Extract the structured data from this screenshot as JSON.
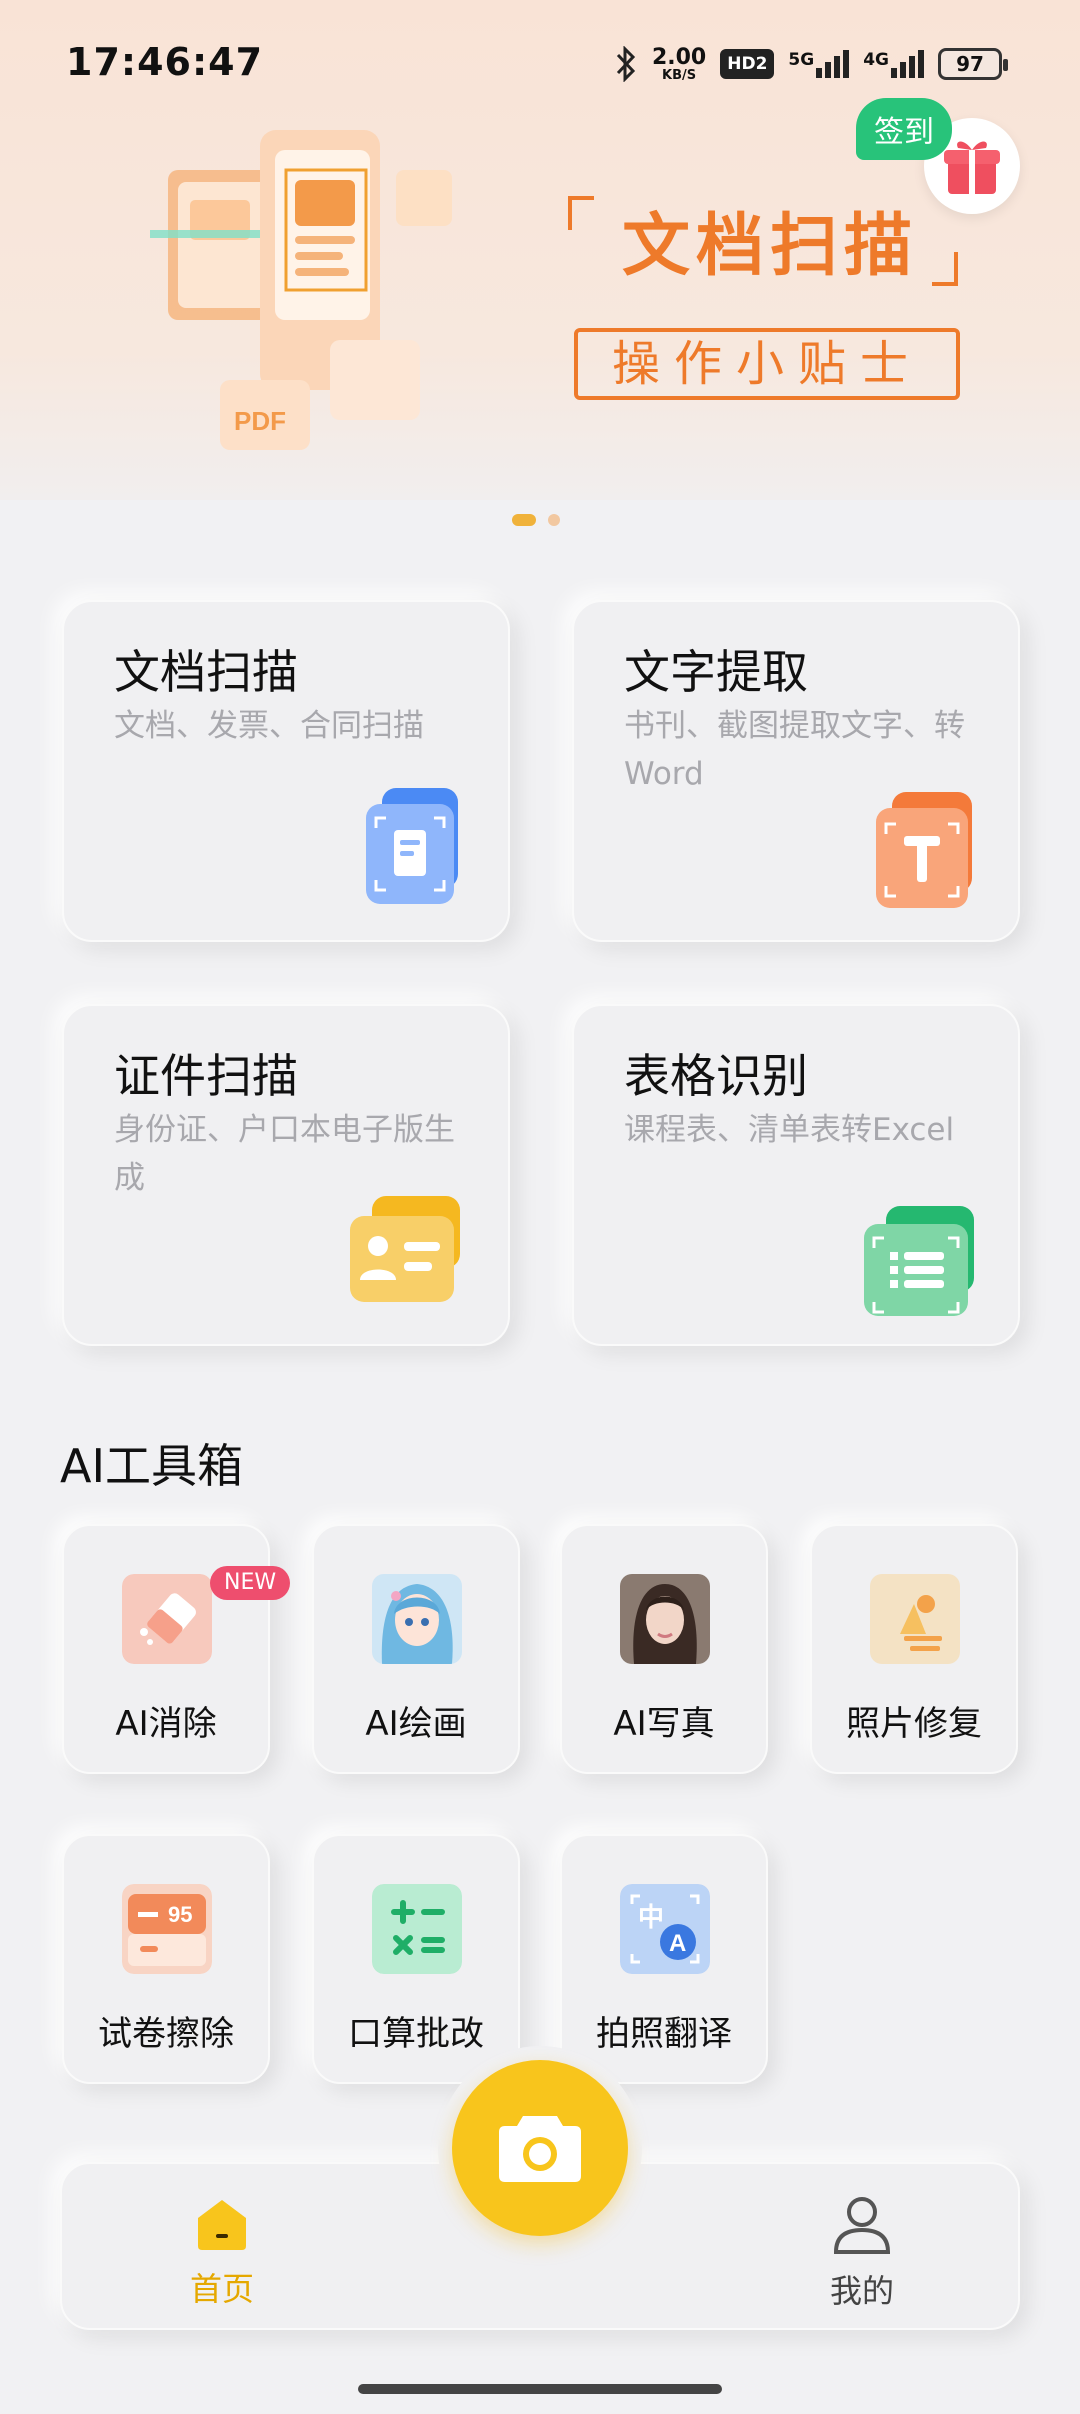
{
  "status_bar": {
    "time": "17:46:47",
    "net_speed_value": "2.00",
    "net_speed_unit": "KB/S",
    "hd": "HD2",
    "net1": "5G",
    "net2": "4G",
    "battery": "97"
  },
  "banner": {
    "title": "文档扫描",
    "subtitle": "操作小贴士",
    "checkin_label": "签到",
    "illustration_label": "PDF",
    "page_count": 2,
    "active_page": 1
  },
  "features": [
    {
      "title": "文档扫描",
      "desc": "文档、发票、合同扫描",
      "icon": "document-scan-icon"
    },
    {
      "title": "文字提取",
      "desc": "书刊、截图提取文字、转Word",
      "icon": "text-extract-icon"
    },
    {
      "title": "证件扫描",
      "desc": "身份证、户口本电子版生成",
      "icon": "id-card-icon"
    },
    {
      "title": "表格识别",
      "desc": "课程表、清单表转Excel",
      "icon": "table-icon"
    }
  ],
  "ai_section": {
    "title": "AI工具箱",
    "tools": [
      {
        "label": "AI消除",
        "badge": "NEW",
        "icon": "eraser-icon"
      },
      {
        "label": "AI绘画",
        "icon": "anime-girl-thumbnail"
      },
      {
        "label": "AI写真",
        "icon": "portrait-thumbnail"
      },
      {
        "label": "照片修复",
        "icon": "photo-repair-icon"
      },
      {
        "label": "试卷擦除",
        "icon": "exam-erase-icon",
        "score_text": "95"
      },
      {
        "label": "口算批改",
        "icon": "math-check-icon"
      },
      {
        "label": "拍照翻译",
        "icon": "translate-icon",
        "glyph_a": "中",
        "glyph_b": "A"
      }
    ]
  },
  "bottom_nav": {
    "home_label": "首页",
    "mine_label": "我的"
  },
  "colors": {
    "accent": "#f8c51c",
    "banner_orange": "#ee7a2a",
    "checkin_green": "#28c37a",
    "badge_red": "#ee4e6e"
  }
}
